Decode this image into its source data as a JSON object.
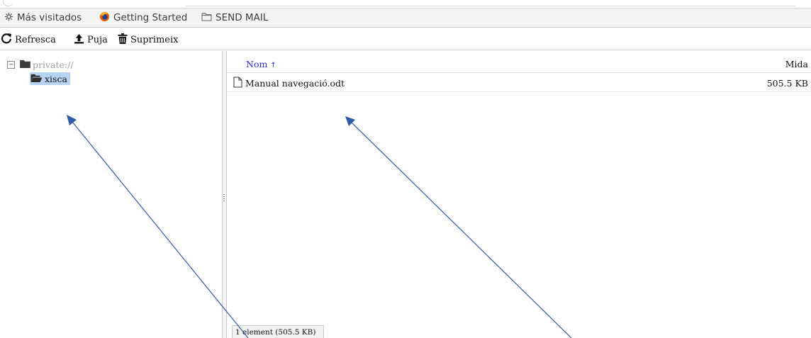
{
  "bookmarks": [
    {
      "label": "Más visitados",
      "icon": "gear-icon"
    },
    {
      "label": "Getting Started",
      "icon": "firefox-icon"
    },
    {
      "label": "SEND MAIL",
      "icon": "folder-icon"
    }
  ],
  "toolbar": {
    "refresh_label": "Refresca",
    "upload_label": "Puja",
    "delete_label": "Suprimeix"
  },
  "tree": {
    "root_label": "private://",
    "child_label": "xisca"
  },
  "filelist": {
    "col_name": "Nom",
    "sort_indicator": "↑",
    "col_size": "Mida",
    "rows": [
      {
        "name": "Manual navegació.odt",
        "size": "505.5 KB"
      }
    ]
  },
  "status": "1 element (505.5 KB)",
  "colors": {
    "accent_link": "#2a2ad8",
    "selected_bg": "#b7d2f3",
    "annotation_arrow": "#2f5aa8"
  }
}
